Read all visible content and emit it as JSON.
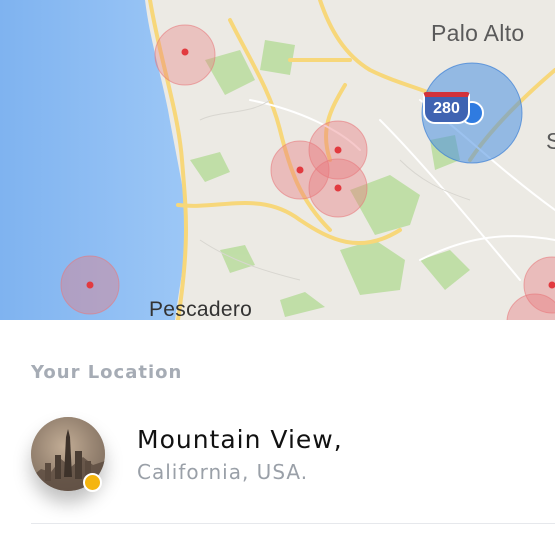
{
  "map": {
    "labels": {
      "palo_alto": "Palo Alto",
      "pescadero": "Pescadero",
      "edge_letter": "S"
    },
    "highway_shield": "280",
    "colors": {
      "ocean": "#86b9f2",
      "land": "#eceae4",
      "park": "#b9dc9e",
      "road": "#f6d77a",
      "marker_red": "#e8787c",
      "marker_blue": "#4a90e2"
    }
  },
  "location": {
    "section_label": "Your Location",
    "city": "Mountain View,",
    "region": "California, USA.",
    "status_color": "#f5b50e"
  }
}
